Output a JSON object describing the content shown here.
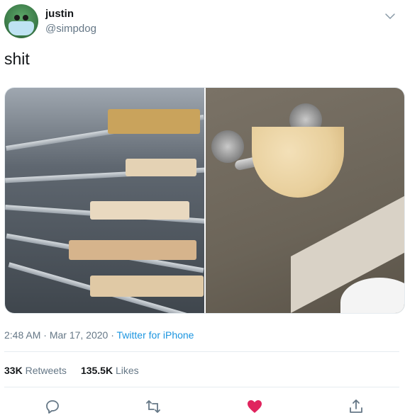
{
  "user": {
    "name": "justin",
    "handle": "@simpdog"
  },
  "tweet": {
    "text": "shit"
  },
  "meta": {
    "time": "2:48 AM",
    "sep": " · ",
    "date": "Mar 17, 2020",
    "source": "Twitter for iPhone"
  },
  "stats": {
    "retweets_count": "33K",
    "retweets_label": "Retweets",
    "likes_count": "135.5K",
    "likes_label": "Likes"
  },
  "icons": {
    "reply": "reply-icon",
    "retweet": "retweet-icon",
    "like": "heart-icon",
    "share": "share-icon",
    "caret": "chevron-down-icon"
  },
  "colors": {
    "link": "#1b95e0",
    "secondary": "#657786",
    "like": "#e0245e",
    "text": "#14171a"
  }
}
